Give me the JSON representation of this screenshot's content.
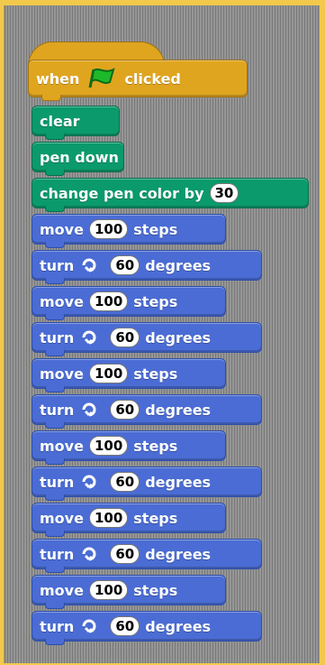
{
  "script": {
    "hat": {
      "when": "when",
      "clicked": "clicked"
    },
    "clear": "clear",
    "pen_down": "pen down",
    "change_pen_color": {
      "label": "change pen color by",
      "value": "30"
    },
    "move": {
      "label": "move",
      "value": "100",
      "unit": "steps"
    },
    "turn": {
      "label": "turn",
      "value": "60",
      "unit": "degrees"
    }
  },
  "icons": {
    "flag": "green-flag-icon",
    "rotate": "rotate-clockwise-icon"
  },
  "colors": {
    "background": "#f2c94c",
    "hat": "#e0a51f",
    "pen": "#0a9a6b",
    "motion": "#4a6cd4"
  }
}
